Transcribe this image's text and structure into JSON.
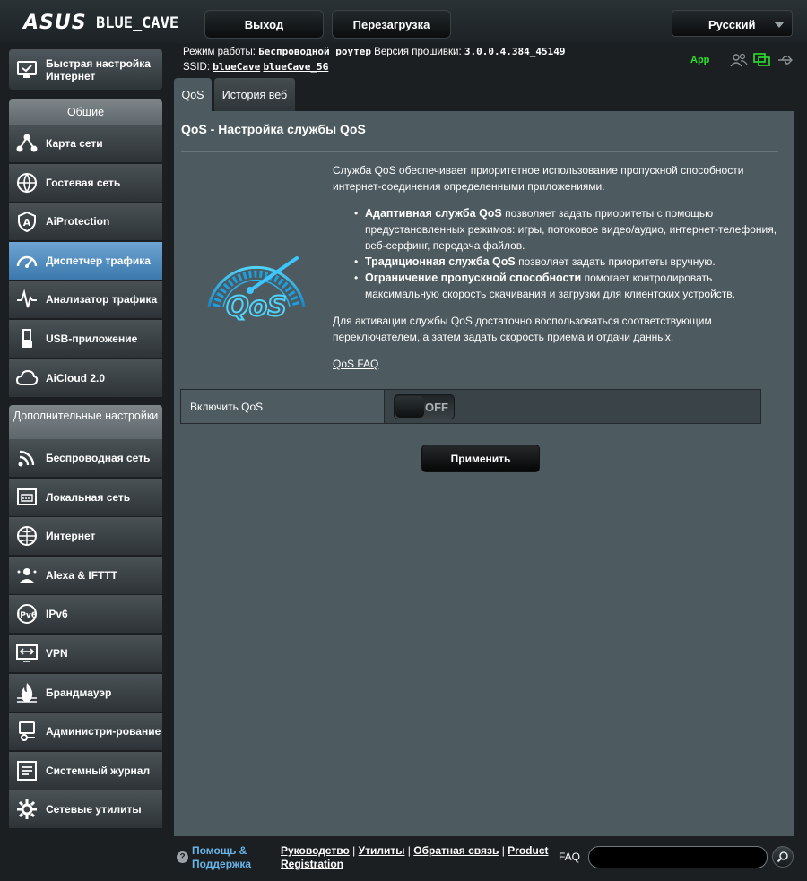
{
  "header": {
    "brand": "ASUS",
    "model": "BLUE_CAVE",
    "logout_label": "Выход",
    "reboot_label": "Перезагрузка",
    "language": "Русский"
  },
  "status": {
    "mode_label": "Режим работы:",
    "mode_value": "Беспроводной роутер",
    "firmware_label": "Версия прошивки:",
    "firmware_value": "3.0.0.4.384_45149",
    "ssid_label": "SSID:",
    "ssid_1": "blueCave",
    "ssid_2": "blueCave_5G",
    "app_label": "App"
  },
  "sidebar": {
    "quick_setup": "Быстрая настройка Интернет",
    "general_title": "Общие",
    "general_items": [
      {
        "label": "Карта сети",
        "icon": "network-map-icon"
      },
      {
        "label": "Гостевая сеть",
        "icon": "guest-network-icon"
      },
      {
        "label": "AiProtection",
        "icon": "aiprotection-icon"
      },
      {
        "label": "Диспетчер трафика",
        "icon": "traffic-manager-icon"
      },
      {
        "label": "Анализатор трафика",
        "icon": "traffic-analyzer-icon"
      },
      {
        "label": "USB-приложение",
        "icon": "usb-app-icon"
      },
      {
        "label": "AiCloud 2.0",
        "icon": "aicloud-icon"
      }
    ],
    "advanced_title": "Дополнительные настройки",
    "advanced_items": [
      {
        "label": "Беспроводная сеть",
        "icon": "wireless-icon"
      },
      {
        "label": "Локальная сеть",
        "icon": "lan-icon"
      },
      {
        "label": "Интернет",
        "icon": "wan-globe-icon"
      },
      {
        "label": "Alexa & IFTTT",
        "icon": "alexa-icon"
      },
      {
        "label": "IPv6",
        "icon": "ipv6-icon"
      },
      {
        "label": "VPN",
        "icon": "vpn-icon"
      },
      {
        "label": "Брандмауэр",
        "icon": "firewall-icon"
      },
      {
        "label": "Администри-рование",
        "icon": "admin-icon"
      },
      {
        "label": "Системный журнал",
        "icon": "syslog-icon"
      },
      {
        "label": "Сетевые утилиты",
        "icon": "network-tools-icon"
      }
    ]
  },
  "tabs": [
    "QoS",
    "История веб"
  ],
  "main": {
    "title": "QoS - Настройка службы QoS",
    "intro": "Служба QoS обеспечивает приоритетное использование пропускной способности интернет-соединения определенными приложениями.",
    "bullets": [
      {
        "bold": "Адаптивная служба QoS",
        "text": " позволяет задать приоритеты с помощью предустановленных режимов: игры, потоковое видео/аудио, интернет-телефония, веб-серфинг, передача файлов."
      },
      {
        "bold": "Традиционная служба QoS",
        "text": " позволяет задать приоритеты вручную."
      },
      {
        "bold": "Ограничение пропускной способности",
        "text": " помогает контролировать максимальную скорость скачивания и загрузки для клиентских устройств."
      }
    ],
    "activation_text": "Для активации службы QoS достаточно воспользоваться соответствующим переключателем, а затем задать скорость приема и отдачи данных.",
    "faq_link": "QoS FAQ",
    "logo_text": "QoS",
    "enable_label": "Включить QoS",
    "toggle_state": "OFF",
    "apply_label": "Применить"
  },
  "footer": {
    "help_label": "Помощь & Поддержка",
    "links": [
      "Руководство",
      "Утилиты",
      "Обратная связь",
      "Product Registration"
    ],
    "faq_label": "FAQ",
    "search_value": ""
  },
  "colors": {
    "accent": "#69b6ea",
    "active_menu": "#4f8fc4",
    "panel": "#4d5a5f",
    "app_green": "#2ee02e"
  }
}
